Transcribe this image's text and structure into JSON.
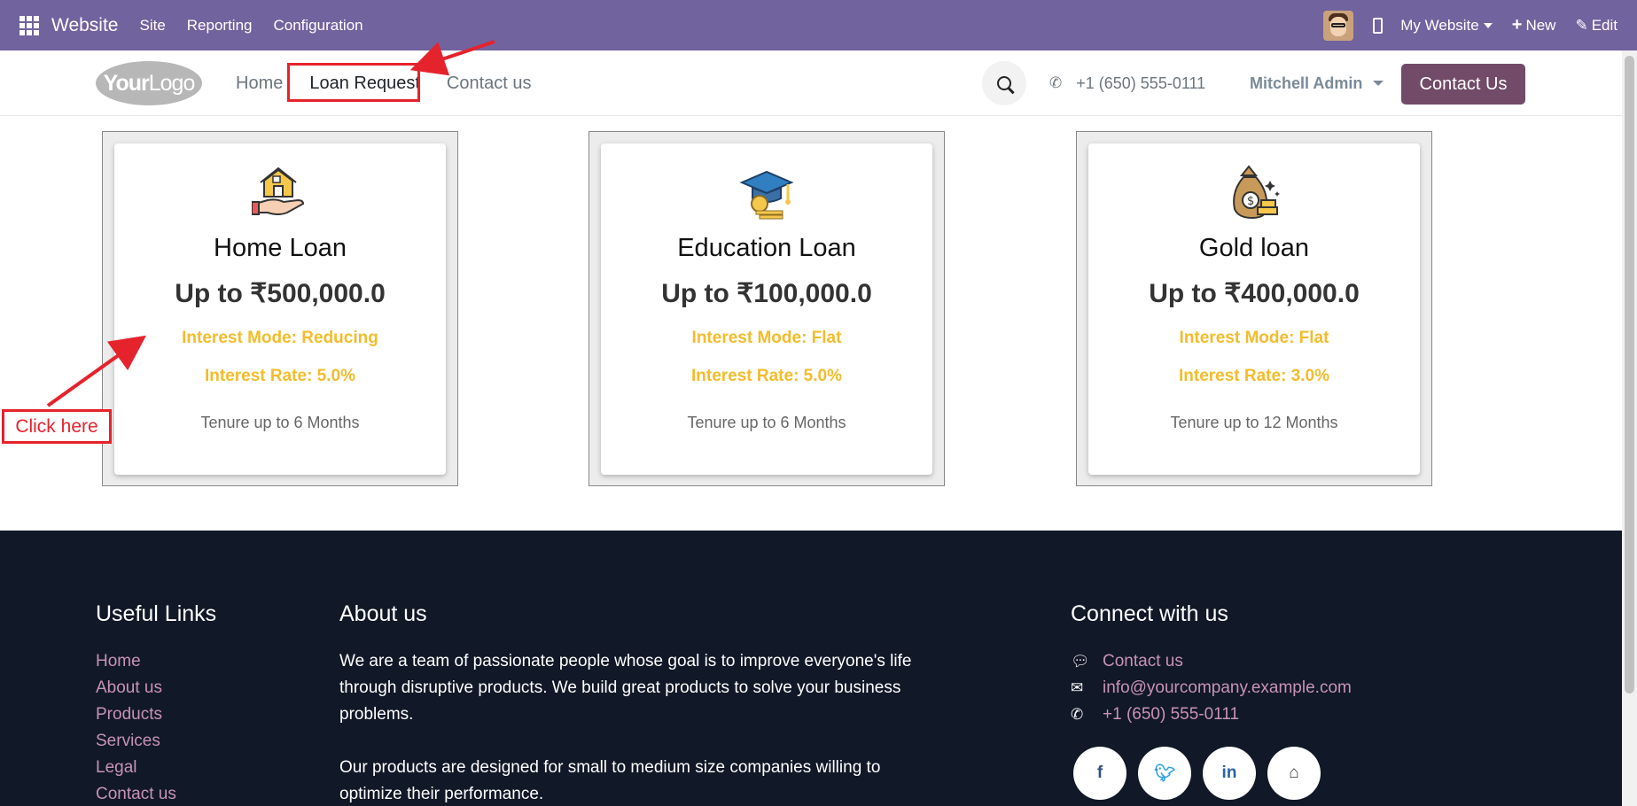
{
  "topbar": {
    "app_name": "Website",
    "menu": [
      "Site",
      "Reporting",
      "Configuration"
    ],
    "my_website": "My Website",
    "new_label": "New",
    "edit_label": "Edit",
    "bg_color": "#71639e"
  },
  "header": {
    "logo_bold": "Your",
    "logo_thin": "Logo",
    "nav": [
      "Home",
      "Loan Request",
      "Contact us"
    ],
    "active_nav": "Loan Request",
    "phone": "+1 (650) 555-0111",
    "user": "Mitchell Admin",
    "contact_button": "Contact Us",
    "accent_color": "#714b67"
  },
  "cards": [
    {
      "icon": "house-in-hand-icon",
      "title": "Home Loan",
      "amount": "Up to ₹500,000.0",
      "interest_mode": "Interest Mode: Reducing",
      "interest_rate": "Interest Rate: 5.0%",
      "tenure": "Tenure up to 6 Months"
    },
    {
      "icon": "graduation-cap-icon",
      "title": "Education Loan",
      "amount": "Up to ₹100,000.0",
      "interest_mode": "Interest Mode: Flat",
      "interest_rate": "Interest Rate: 5.0%",
      "tenure": "Tenure up to 6 Months"
    },
    {
      "icon": "money-bag-gold-icon",
      "title": "Gold loan",
      "amount": "Up to ₹400,000.0",
      "interest_mode": "Interest Mode: Flat",
      "interest_rate": "Interest Rate: 3.0%",
      "tenure": "Tenure up to 12 Months"
    }
  ],
  "annotation": {
    "click_here": "Click here",
    "color": "#e5232c"
  },
  "footer": {
    "useful_links_title": "Useful Links",
    "useful_links": [
      "Home",
      "About us",
      "Products",
      "Services",
      "Legal",
      "Contact us"
    ],
    "about_title": "About us",
    "about_p1": "We are a team of passionate people whose goal is to improve everyone's life through disruptive products. We build great products to solve your business problems.",
    "about_p2": "Our products are designed for small to medium size companies willing to optimize their performance.",
    "connect_title": "Connect with us",
    "connect_contact": "Contact us",
    "connect_email": "info@yourcompany.example.com",
    "connect_phone": "+1 (650) 555-0111",
    "socials": [
      "facebook-icon",
      "twitter-icon",
      "linkedin-icon",
      "home-icon"
    ],
    "bg_color": "#111827",
    "link_color": "#c793b6"
  }
}
